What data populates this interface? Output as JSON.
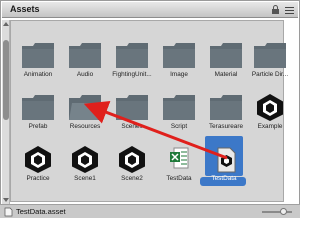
{
  "window": {
    "title": "Assets"
  },
  "assets": [
    {
      "label": "Animation",
      "kind": "folder"
    },
    {
      "label": "Audio",
      "kind": "folder"
    },
    {
      "label": "FightingUnit...",
      "kind": "folder"
    },
    {
      "label": "Image",
      "kind": "folder"
    },
    {
      "label": "Material",
      "kind": "folder"
    },
    {
      "label": "Particle Dir...",
      "kind": "folder"
    },
    {
      "label": "Prefab",
      "kind": "folder"
    },
    {
      "label": "Resources",
      "kind": "folder-open"
    },
    {
      "label": "Scenes",
      "kind": "folder"
    },
    {
      "label": "Script",
      "kind": "folder"
    },
    {
      "label": "Terasureare",
      "kind": "folder"
    },
    {
      "label": "Example",
      "kind": "unity-scene"
    },
    {
      "label": "Practice",
      "kind": "unity-scene"
    },
    {
      "label": "Scene1",
      "kind": "unity-scene"
    },
    {
      "label": "Scene2",
      "kind": "unity-scene"
    },
    {
      "label": "TestData",
      "kind": "spreadsheet"
    },
    {
      "label": "TestData",
      "kind": "unity-asset",
      "selected": true
    }
  ],
  "status": {
    "path": "TestData.asset"
  },
  "colors": {
    "selection": "#3c78c8",
    "annotation_arrow": "#e0201c",
    "folder": "#5f6b73"
  }
}
